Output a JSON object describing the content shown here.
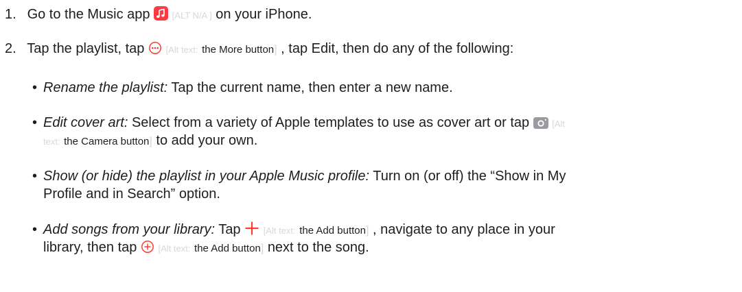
{
  "colors": {
    "text": "#1d1d1f",
    "accent": "#ff3b30",
    "alt_muted": "#d7d7dc",
    "camera_gray": "#9a9aa0"
  },
  "icons": [
    "music-app-icon",
    "more-icon",
    "camera-icon",
    "plus-icon",
    "add-circle-icon"
  ],
  "steps": [
    {
      "number": "1.",
      "before": "Go to the Music app",
      "alt_prefix": "[ALT N/A ]",
      "after": "on your iPhone."
    },
    {
      "number": "2.",
      "before": "Tap the playlist, tap",
      "alt_prefix": "[Alt text:",
      "alt_text": "the More button",
      "alt_close": "]",
      "after": ", tap Edit, then do any of the following:"
    }
  ],
  "bullets": [
    {
      "title": "Rename the playlist:",
      "text": "Tap the current name, then enter a new name."
    },
    {
      "title": "Edit cover art:",
      "text": "Select from a variety of Apple templates to use as cover art or tap",
      "alt_prefix_1": "[Alt",
      "alt_prefix_2": "text:",
      "alt_text": "the Camera button",
      "alt_close": "]",
      "after": "to add your own."
    },
    {
      "title": "Show (or hide) the playlist in your Apple Music profile:",
      "text_line1": "Turn on (or off) the “Show in My",
      "text_line2": "Profile and in Search” option."
    },
    {
      "title": "Add songs from your library:",
      "text": "Tap",
      "alt_prefix": "[Alt text:",
      "alt_text": "the Add button",
      "alt_close": "]",
      "after_line1": ", navigate to any place in your",
      "line2_before": "library, then tap",
      "alt2_prefix": "[Alt text:",
      "alt2_text": "the Add button",
      "alt2_close": "]",
      "after_line2": "next to the song."
    }
  ],
  "bullet_char": "•"
}
